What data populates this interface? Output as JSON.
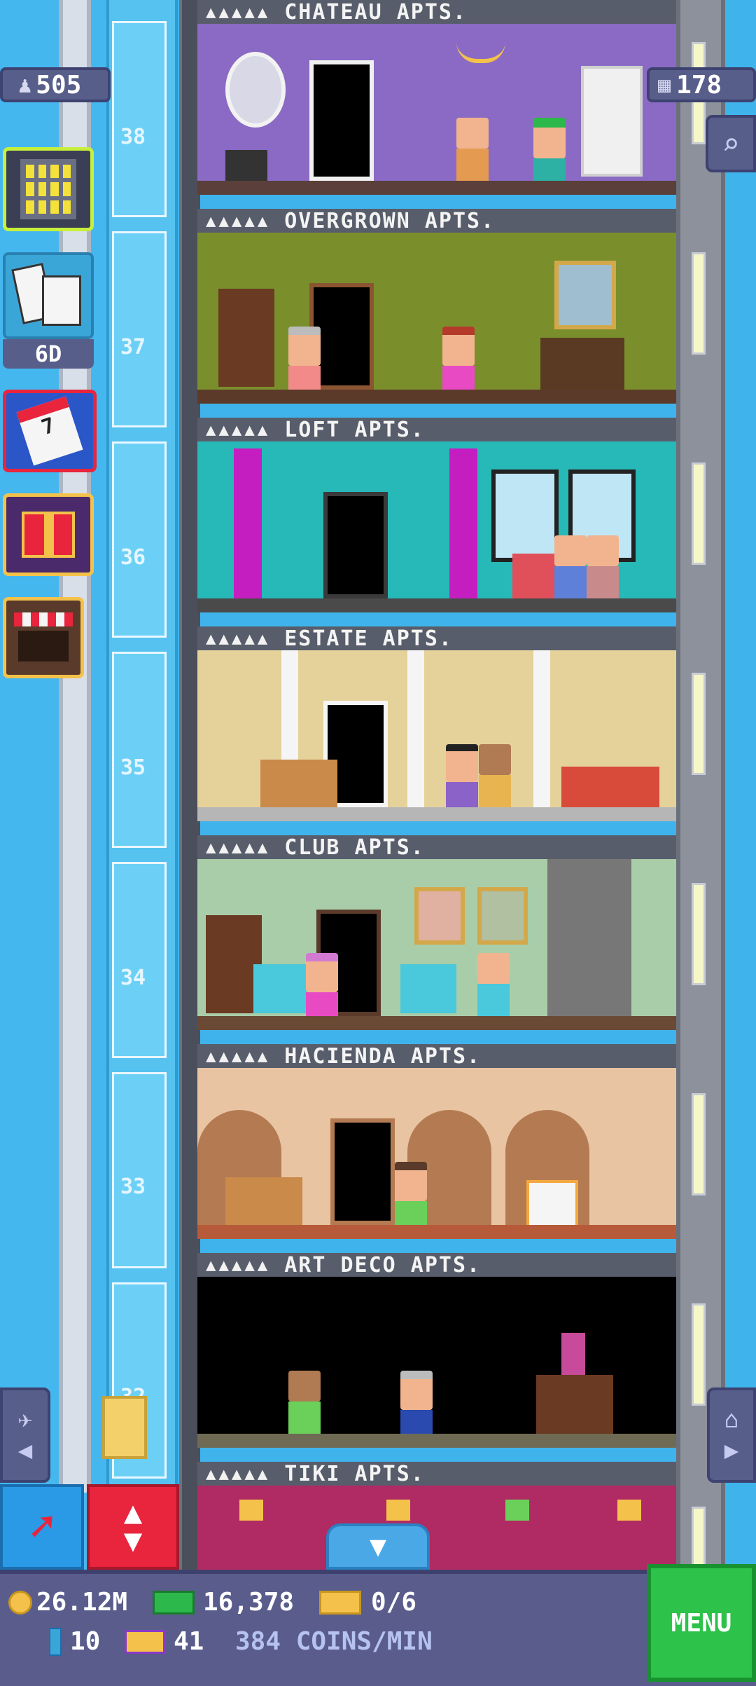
{
  "stats": {
    "population": "505",
    "floors_count": "178",
    "tasks_timer": "6D"
  },
  "elevator": {
    "floor_numbers": [
      "38",
      "37",
      "36",
      "35",
      "34",
      "33",
      "32"
    ]
  },
  "floors": [
    {
      "stars": "▲▲▲▲▲",
      "name": "CHATEAU APTS.",
      "wall": "#8a6ac4",
      "accent": "#6e52a8",
      "floor": "#5a3f3a"
    },
    {
      "stars": "▲▲▲▲▲",
      "name": "OVERGROWN APTS.",
      "wall": "#7a8f2c",
      "accent": "#5f7120",
      "floor": "#5b3a2a"
    },
    {
      "stars": "▲▲▲▲▲",
      "name": "LOFT APTS.",
      "wall": "#27b9b7",
      "accent": "#1e9a98",
      "floor": "#4a4a4a"
    },
    {
      "stars": "▲▲▲▲▲",
      "name": "ESTATE APTS.",
      "wall": "#e5d29a",
      "accent": "#c9b57a",
      "floor": "#b6b6b6"
    },
    {
      "stars": "▲▲▲▲▲",
      "name": "CLUB APTS.",
      "wall": "#a9cda8",
      "accent": "#8bb08a",
      "floor": "#6b4a35"
    },
    {
      "stars": "▲▲▲▲▲",
      "name": "HACIENDA APTS.",
      "wall": "#e8c4a2",
      "accent": "#b47b52",
      "floor": "#b65a3a"
    },
    {
      "stars": "▲▲▲▲▲",
      "name": "ART DECO APTS.",
      "wall": "#000000",
      "accent": "#1b1b1b",
      "floor": "#6f6a54"
    },
    {
      "stars": "▲▲▲▲▲",
      "name": "TIKI APTS.",
      "wall": "#b02a64",
      "accent": "#d63a80",
      "floor": "#7a1e48"
    }
  ],
  "bottom_bar": {
    "coins": "26.12M",
    "bux": "16,378",
    "tickets": "0/6",
    "bits": "10",
    "vip": "41",
    "rate": "384 COINS/MIN",
    "menu_label": "MENU"
  },
  "icons": {
    "population": "person-icon",
    "floors": "building-icon",
    "search": "magnifier-icon",
    "build": "building-grid-icon",
    "tasks": "dominoes-checklist-icon",
    "calendar": "calendar-icon",
    "gift": "gift-icon",
    "shop": "market-stall-icon",
    "raffle": "plane-icon",
    "home": "house-icon",
    "arrow_tool": "red-arrow-icon",
    "elevator": "up-down-arrows-icon",
    "scroll_down": "chevron-down-icon",
    "coins": "coin-icon",
    "bux": "bux-icon",
    "tickets": "ticket-icon",
    "bits": "bit-icon",
    "vip": "vip-icon"
  },
  "colors": {
    "sky": "#3fb4ec",
    "bar": "#5a5d8c",
    "menu": "#2dc24a",
    "red_button": "#e8253d",
    "blue_button": "#2a9ae6"
  }
}
